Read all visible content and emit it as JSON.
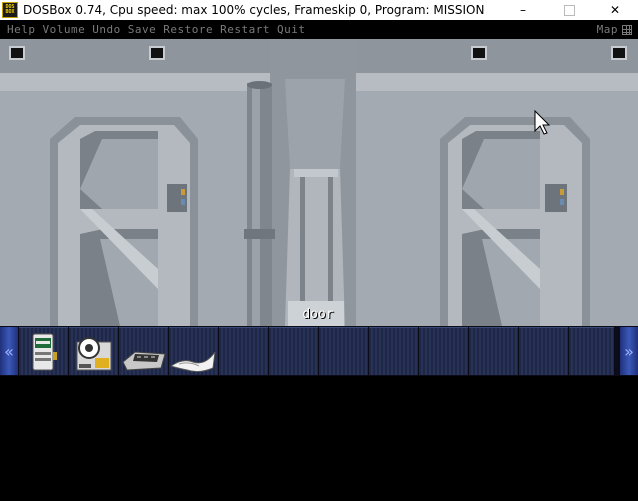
{
  "window": {
    "title": "DOSBox 0.74, Cpu speed: max 100% cycles, Frameskip  0, Program:  MISSION",
    "icon_text_top": "DOS",
    "icon_text_bottom": "BOX",
    "minimize_icon": "minimize-icon",
    "maximize_icon": "maximize-icon",
    "close_icon": "close-icon"
  },
  "menu": {
    "items": [
      "Help",
      "Volume",
      "Undo",
      "Save",
      "Restore",
      "Restart",
      "Quit"
    ],
    "map_label": "Map"
  },
  "scene": {
    "hotspot_label": "door"
  },
  "inventory": {
    "left_arrow": "«",
    "right_arrow": "»",
    "items": [
      "id-badge-icon",
      "tape-reel-icon",
      "keypad-device-icon",
      "paper-icon"
    ]
  },
  "colors": {
    "menu_text": "#7a7a7a",
    "inventory_slot": "#1e2846",
    "arrow_blue": "#3a58b8"
  }
}
